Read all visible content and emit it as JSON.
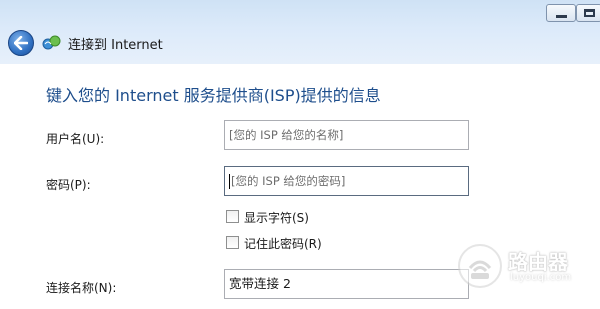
{
  "window": {
    "title": "连接到 Internet"
  },
  "form": {
    "heading": "键入您的 Internet 服务提供商(ISP)提供的信息",
    "username_label": "用户名(U):",
    "username_placeholder": "[您的 ISP 给您的名称]",
    "password_label": "密码(P):",
    "password_placeholder": "[您的 ISP 给您的密码]",
    "show_chars_label": "显示字符(S)",
    "remember_label": "记住此密码(R)",
    "connection_name_label": "连接名称(N):",
    "connection_name_value": "宽带连接 2"
  },
  "watermark": {
    "name": "路由器",
    "url": "luyouqi.com"
  }
}
